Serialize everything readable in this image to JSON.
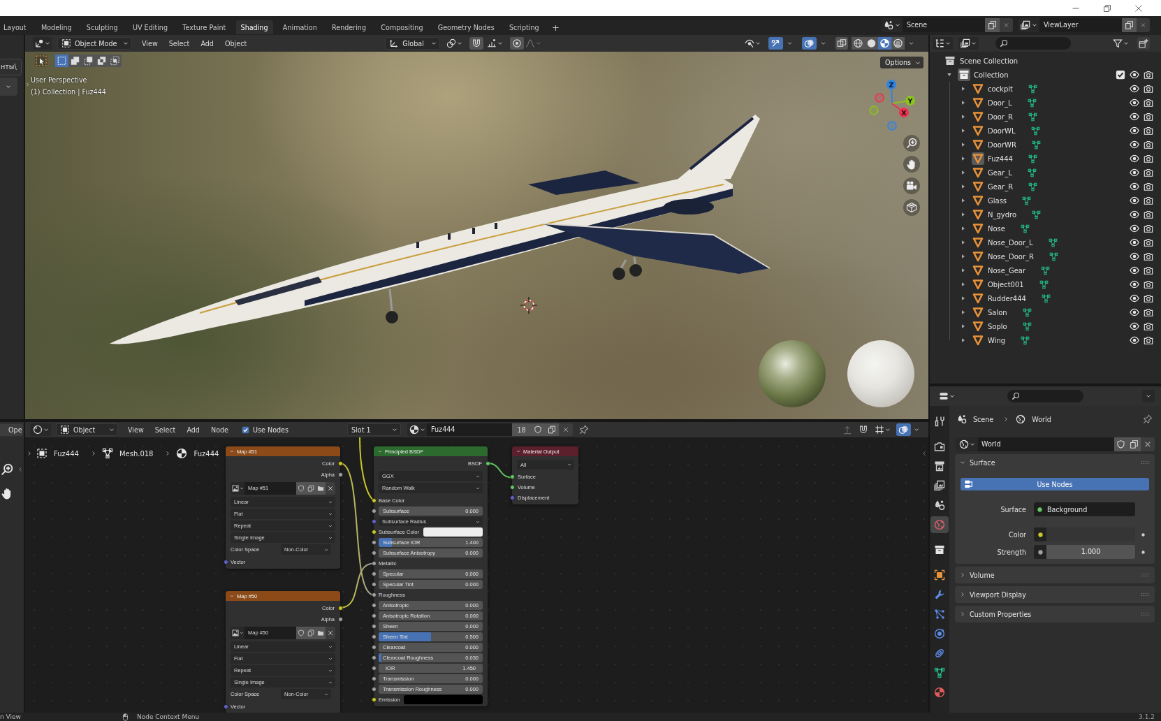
{
  "workspace_tabs": [
    {
      "label": "Layout",
      "selected": false
    },
    {
      "label": "Modeling",
      "selected": false
    },
    {
      "label": "Sculpting",
      "selected": false
    },
    {
      "label": "UV Editing",
      "selected": false
    },
    {
      "label": "Texture Paint",
      "selected": false
    },
    {
      "label": "Shading",
      "selected": true
    },
    {
      "label": "Animation",
      "selected": false
    },
    {
      "label": "Rendering",
      "selected": false
    },
    {
      "label": "Compositing",
      "selected": false
    },
    {
      "label": "Geometry Nodes",
      "selected": false
    },
    {
      "label": "Scripting",
      "selected": false
    }
  ],
  "add_tab": "+",
  "scene_selector": {
    "value": "Scene"
  },
  "view_layer_selector": {
    "value": "ViewLayer"
  },
  "file_browser": {
    "path": "нты\\"
  },
  "image_editor": {
    "open_button": "Ope"
  },
  "viewport": {
    "mode": "Object Mode",
    "menus": [
      "View",
      "Select",
      "Add",
      "Object"
    ],
    "orientation": "Global",
    "toggles": {
      "gizmos": true,
      "overlays": true,
      "xray": false
    },
    "shading_modes": [
      {
        "kind": "wireframe",
        "selected": false
      },
      {
        "kind": "solid",
        "selected": false
      },
      {
        "kind": "material",
        "selected": true
      },
      {
        "kind": "rendered",
        "selected": false
      }
    ],
    "select_modes": [
      {
        "kind": "set",
        "selected": true
      },
      {
        "kind": "extend",
        "selected": false
      },
      {
        "kind": "subtract",
        "selected": false
      },
      {
        "kind": "invert",
        "selected": false
      },
      {
        "kind": "intersect",
        "selected": false
      }
    ],
    "options_button": "Options",
    "view_name": "User Perspective",
    "view_info": "(1) Collection | Fuz444",
    "gizmo_axes": [
      {
        "label": "Z",
        "color": "#2f83e6"
      },
      {
        "label": "Y",
        "color": "#8bc31f"
      },
      {
        "label": "X",
        "color": "#ef3050"
      }
    ]
  },
  "outliner": {
    "tree": [
      {
        "label": "Scene Collection",
        "kind": "scene_collection",
        "active": false,
        "children": [
          {
            "label": "Collection",
            "kind": "collection",
            "expanded": true,
            "checked": true,
            "active": true,
            "children": [
              {
                "label": "cockpit",
                "kind": "object",
                "expanded": false,
                "active": false
              },
              {
                "label": "Door_L",
                "kind": "object",
                "expanded": false,
                "active": false
              },
              {
                "label": "Door_R",
                "kind": "object",
                "expanded": false,
                "active": false
              },
              {
                "label": "DoorWL",
                "kind": "object",
                "expanded": false,
                "active": false
              },
              {
                "label": "DoorWR",
                "kind": "object",
                "expanded": false,
                "active": false
              },
              {
                "label": "Fuz444",
                "kind": "object",
                "expanded": false,
                "active": true
              },
              {
                "label": "Gear_L",
                "kind": "object",
                "expanded": false,
                "active": false
              },
              {
                "label": "Gear_R",
                "kind": "object",
                "expanded": false,
                "active": false
              },
              {
                "label": "Glass",
                "kind": "object",
                "expanded": false,
                "active": false
              },
              {
                "label": "N_gydro",
                "kind": "object",
                "expanded": false,
                "active": false
              },
              {
                "label": "Nose",
                "kind": "object",
                "expanded": false,
                "active": false
              },
              {
                "label": "Nose_Door_L",
                "kind": "object",
                "expanded": false,
                "active": false
              },
              {
                "label": "Nose_Door_R",
                "kind": "object",
                "expanded": false,
                "active": false
              },
              {
                "label": "Nose_Gear",
                "kind": "object",
                "expanded": false,
                "active": false
              },
              {
                "label": "Object001",
                "kind": "object",
                "expanded": false,
                "active": false
              },
              {
                "label": "Rudder444",
                "kind": "object",
                "expanded": false,
                "active": false
              },
              {
                "label": "Salon",
                "kind": "object",
                "expanded": false,
                "active": false
              },
              {
                "label": "Soplo",
                "kind": "object",
                "expanded": false,
                "active": false
              },
              {
                "label": "Wing",
                "kind": "object",
                "expanded": false,
                "active": false
              }
            ]
          }
        ]
      }
    ]
  },
  "properties": {
    "tabs": [
      {
        "kind": "tool",
        "selected": false
      },
      {
        "kind": "render",
        "selected": false
      },
      {
        "kind": "output",
        "selected": false
      },
      {
        "kind": "view_layer",
        "selected": false
      },
      {
        "kind": "scene",
        "selected": false
      },
      {
        "kind": "world",
        "selected": true
      },
      {
        "kind": "collection",
        "selected": false
      },
      {
        "kind": "object",
        "selected": false
      },
      {
        "kind": "modifiers",
        "selected": false
      },
      {
        "kind": "particles",
        "selected": false
      },
      {
        "kind": "physics",
        "selected": false
      },
      {
        "kind": "constraints",
        "selected": false
      },
      {
        "kind": "data",
        "selected": false
      },
      {
        "kind": "material",
        "selected": false
      }
    ],
    "breadcrumb": [
      {
        "kind": "scene",
        "label": "Scene"
      },
      {
        "kind": "world",
        "label": "World"
      }
    ],
    "world_name": "World",
    "panels": [
      {
        "title": "Surface",
        "expanded": true,
        "use_nodes": {
          "label": "Use Nodes",
          "on": true
        },
        "fields": [
          {
            "kind": "shader",
            "label": "Surface",
            "value": "Background",
            "socket": {
              "color": "#63c763"
            }
          },
          {
            "kind": "color",
            "label": "Color",
            "swatch": {
              "color": "#353535"
            },
            "socket": {
              "color": "#c7c729"
            }
          },
          {
            "kind": "number",
            "label": "Strength",
            "value": "1.000",
            "socket": {
              "color": "#a1a1a1"
            }
          }
        ]
      },
      {
        "title": "Volume",
        "expanded": false
      },
      {
        "title": "Viewport Display",
        "expanded": false
      },
      {
        "title": "Custom Properties",
        "expanded": false
      }
    ]
  },
  "node_editor": {
    "mode": "Object",
    "menus": [
      "View",
      "Select",
      "Add",
      "Node"
    ],
    "use_nodes": {
      "label": "Use Nodes",
      "checked": true
    },
    "slot": "Slot 1",
    "material": "Fuz444",
    "users": "18",
    "breadcrumb": [
      {
        "kind": "object",
        "label": "Fuz444"
      },
      {
        "kind": "mesh",
        "label": "Mesh.018"
      },
      {
        "kind": "material",
        "label": "Fuz444"
      }
    ],
    "nodes": [
      {
        "kind": "image_texture",
        "title": "Map #51",
        "outputs": [
          {
            "label": "Color",
            "socket": {
              "color": "#c7c729"
            }
          },
          {
            "label": "Alpha",
            "socket": {
              "color": "#a1a1a1"
            }
          }
        ],
        "image": "Map #51",
        "options": [
          "Linear",
          "Flat",
          "Repeat",
          "Single Image"
        ],
        "color_space": {
          "label": "Color Space",
          "value": "Non-Color"
        },
        "inputs": [
          {
            "kind": "label",
            "label": "Vector",
            "socket": {
              "color": "#6363c7"
            }
          }
        ]
      },
      {
        "kind": "image_texture",
        "title": "Map #50",
        "outputs": [
          {
            "label": "Color",
            "socket": {
              "color": "#c7c729"
            }
          },
          {
            "label": "Alpha",
            "socket": {
              "color": "#a1a1a1"
            }
          }
        ],
        "image": "Map #50",
        "options": [
          "Linear",
          "Flat",
          "Repeat",
          "Single Image"
        ],
        "color_space": {
          "label": "Color Space",
          "value": "Non-Color"
        },
        "inputs": [
          {
            "kind": "label",
            "label": "Vector",
            "socket": {
              "color": "#6363c7"
            }
          }
        ]
      },
      {
        "kind": "principled",
        "title": "Principled BSDF",
        "outputs": [
          {
            "label": "BSDF",
            "socket": {
              "color": "#63c763"
            }
          }
        ],
        "options": [
          "GGX",
          "Random Walk"
        ],
        "inputs": [
          {
            "kind": "label",
            "label": "Base Color",
            "socket": {
              "color": "#c7c729"
            }
          },
          {
            "kind": "slider",
            "label": "Subsurface",
            "value": "0.000",
            "socket": {
              "color": "#a1a1a1"
            }
          },
          {
            "kind": "dropdown",
            "label": "Subsurface Radius",
            "socket": {
              "color": "#6363c7"
            }
          },
          {
            "kind": "swatch",
            "label": "Subsurface Color",
            "swatch": {
              "color": "#eeeeee"
            },
            "socket": {
              "color": "#c7c729"
            }
          },
          {
            "kind": "slider",
            "label": "Subsurface IOR",
            "value": "1.400",
            "level": 0.13,
            "socket": {
              "color": "#a1a1a1"
            }
          },
          {
            "kind": "slider",
            "label": "Subsurface Anisotropy",
            "value": "0.000",
            "socket": {
              "color": "#a1a1a1"
            }
          },
          {
            "kind": "label",
            "label": "Metallic",
            "socket": {
              "color": "#a1a1a1"
            }
          },
          {
            "kind": "slider",
            "label": "Specular",
            "value": "0.000",
            "socket": {
              "color": "#a1a1a1"
            }
          },
          {
            "kind": "slider",
            "label": "Specular Tint",
            "value": "0.000",
            "socket": {
              "color": "#a1a1a1"
            }
          },
          {
            "kind": "label",
            "label": "Roughness",
            "socket": {
              "color": "#a1a1a1"
            }
          },
          {
            "kind": "slider",
            "label": "Anisotropic",
            "value": "0.000",
            "socket": {
              "color": "#a1a1a1"
            }
          },
          {
            "kind": "slider",
            "label": "Anisotropic Rotation",
            "value": "0.000",
            "socket": {
              "color": "#a1a1a1"
            }
          },
          {
            "kind": "slider",
            "label": "Sheen",
            "value": "0.000",
            "socket": {
              "color": "#a1a1a1"
            }
          },
          {
            "kind": "slider",
            "label": "Sheen Tint",
            "value": "0.500",
            "level": 0.5,
            "socket": {
              "color": "#a1a1a1"
            }
          },
          {
            "kind": "slider",
            "label": "Clearcoat",
            "value": "0.000",
            "socket": {
              "color": "#a1a1a1"
            }
          },
          {
            "kind": "slider",
            "label": "Clearcoat Roughness",
            "value": "0.030",
            "level": 0.03,
            "socket": {
              "color": "#a1a1a1"
            }
          },
          {
            "kind": "number",
            "label": "IOR",
            "value": "1.450",
            "socket": {
              "color": "#a1a1a1"
            }
          },
          {
            "kind": "slider",
            "label": "Transmission",
            "value": "0.000",
            "socket": {
              "color": "#a1a1a1"
            }
          },
          {
            "kind": "slider",
            "label": "Transmission Roughness",
            "value": "0.000",
            "socket": {
              "color": "#a1a1a1"
            }
          },
          {
            "kind": "swatch",
            "label": "Emission",
            "swatch": {
              "color": "#000000"
            },
            "socket": {
              "color": "#c7c729"
            }
          }
        ]
      },
      {
        "kind": "output",
        "title": "Material Output",
        "options": [
          "All"
        ],
        "inputs": [
          {
            "kind": "label",
            "label": "Surface",
            "socket": {
              "color": "#63c763"
            }
          },
          {
            "kind": "label",
            "label": "Volume",
            "socket": {
              "color": "#63c763"
            }
          },
          {
            "kind": "label",
            "label": "Displacement",
            "socket": {
              "color": "#6363c7"
            }
          }
        ]
      }
    ]
  },
  "status_bar": {
    "hints": [
      {
        "label": "n View",
        "mouse_icon": false
      },
      {
        "label": "Node Context Menu",
        "mouse_icon": true
      }
    ],
    "version": "3.1.2"
  }
}
